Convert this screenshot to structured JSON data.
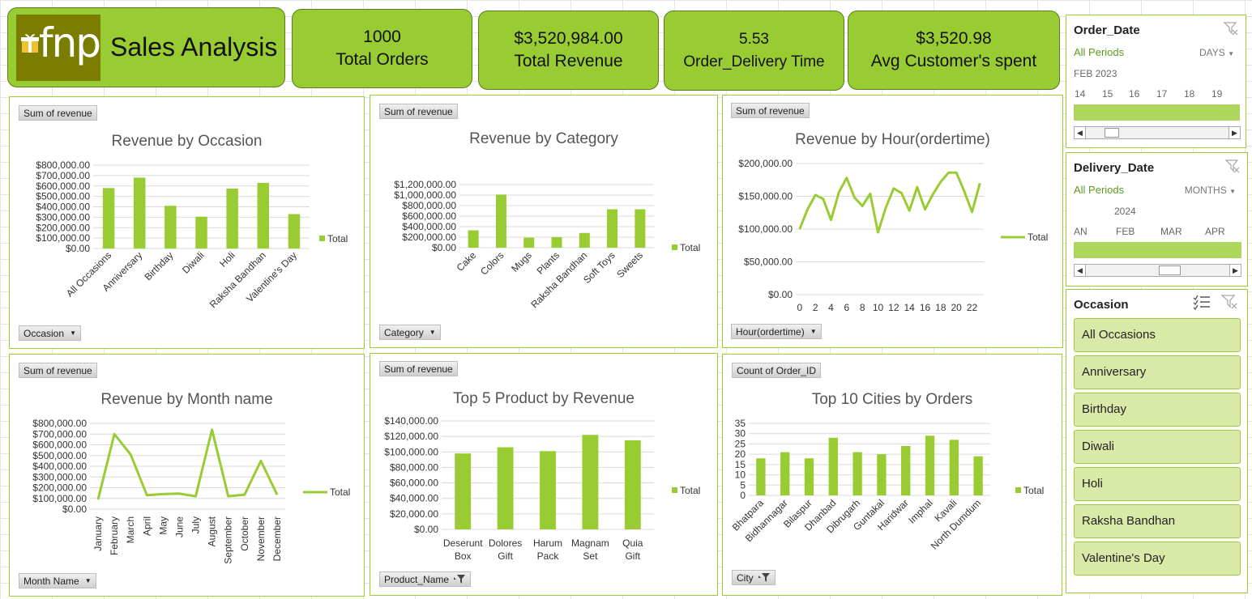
{
  "header": {
    "logo_text": "fnp",
    "title": "Sales Analysis"
  },
  "kpis": [
    {
      "value": "1000",
      "label": "Total Orders"
    },
    {
      "value": "$3,520,984.00",
      "label": "Total Revenue"
    },
    {
      "value": "5.53",
      "label": "Order_Delivery Time"
    },
    {
      "value": "$3,520.98",
      "label": "Avg Customer's spent"
    }
  ],
  "colors": {
    "accent": "#99cc33",
    "bar": "#99cc33",
    "line": "#99cc33",
    "slicer_fill": "#d9eaa8",
    "border": "#9acd32"
  },
  "legend_label": "Total",
  "chart_data": [
    {
      "id": "occasion",
      "type": "bar",
      "title": "Revenue by Occasion",
      "value_field": "Sum of revenue",
      "axis_field": "Occasion",
      "categories": [
        "All Occasions",
        "Anniversary",
        "Birthday",
        "Diwali",
        "Holi",
        "Raksha Bandhan",
        "Valentine's Day"
      ],
      "values": [
        580000,
        680000,
        410000,
        305000,
        575000,
        630000,
        330000
      ],
      "yticks": [
        "$0.00",
        "$100,000.00",
        "$200,000.00",
        "$300,000.00",
        "$400,000.00",
        "$500,000.00",
        "$600,000.00",
        "$700,000.00",
        "$800,000.00"
      ],
      "ylim": [
        0,
        800000
      ],
      "legend": "right"
    },
    {
      "id": "category",
      "type": "bar",
      "title": "Revenue by Category",
      "value_field": "Sum of revenue",
      "axis_field": "Category",
      "categories": [
        "Cake",
        "Colors",
        "Mugs",
        "Plants",
        "Raksha Bandhan",
        "Soft Toys",
        "Sweets"
      ],
      "values": [
        330000,
        1010000,
        190000,
        200000,
        280000,
        730000,
        730000
      ],
      "yticks": [
        "$0.00",
        "$200,000.00",
        "$400,000.00",
        "$600,000.00",
        "$800,000.00",
        "$1,000,000.00",
        "$1,200,000.00"
      ],
      "ylim": [
        0,
        1200000
      ],
      "legend": "right"
    },
    {
      "id": "hour",
      "type": "line",
      "title": "Revenue by Hour(ordertime)",
      "value_field": "Sum of revenue",
      "axis_field": "Hour(ordertime)",
      "x": [
        0,
        1,
        2,
        3,
        4,
        5,
        6,
        7,
        8,
        9,
        10,
        11,
        12,
        13,
        14,
        15,
        16,
        17,
        18,
        19,
        20,
        21,
        22,
        23
      ],
      "values": [
        100000,
        130000,
        152000,
        146000,
        114000,
        156000,
        178000,
        148000,
        135000,
        154000,
        95000,
        133000,
        162000,
        155000,
        128000,
        164000,
        130000,
        153000,
        172000,
        186000,
        186000,
        158000,
        126000,
        170000
      ],
      "xticks": [
        "0",
        "2",
        "4",
        "6",
        "8",
        "10",
        "12",
        "14",
        "16",
        "18",
        "20",
        "22"
      ],
      "yticks": [
        "$0.00",
        "$50,000.00",
        "$100,000.00",
        "$150,000.00",
        "$200,000.00"
      ],
      "ylim": [
        0,
        200000
      ],
      "legend": "right"
    },
    {
      "id": "month",
      "type": "line",
      "title": "Revenue by Month name",
      "value_field": "Sum of revenue",
      "axis_field": "Month Name",
      "categories": [
        "January",
        "February",
        "March",
        "April",
        "May",
        "June",
        "July",
        "August",
        "September",
        "October",
        "November",
        "December"
      ],
      "values": [
        90000,
        700000,
        510000,
        130000,
        140000,
        145000,
        120000,
        740000,
        120000,
        135000,
        450000,
        135000
      ],
      "yticks": [
        "$0.00",
        "$100,000.00",
        "$200,000.00",
        "$300,000.00",
        "$400,000.00",
        "$500,000.00",
        "$600,000.00",
        "$700,000.00",
        "$800,000.00"
      ],
      "ylim": [
        0,
        800000
      ],
      "legend": "right"
    },
    {
      "id": "product",
      "type": "bar",
      "title": "Top 5 Product by Revenue",
      "value_field": "Sum of revenue",
      "axis_field": "Product_Name",
      "categories": [
        "Deserunt Box",
        "Dolores Gift",
        "Harum Pack",
        "Magnam Set",
        "Quia Gift"
      ],
      "values": [
        98000,
        106000,
        101000,
        122000,
        115000
      ],
      "yticks": [
        "$0.00",
        "$20,000.00",
        "$40,000.00",
        "$60,000.00",
        "$80,000.00",
        "$100,000.00",
        "$120,000.00",
        "$140,000.00"
      ],
      "ylim": [
        0,
        140000
      ],
      "legend": "right"
    },
    {
      "id": "cities",
      "type": "bar",
      "title": "Top 10 Cities by Orders",
      "value_field": "Count of Order_ID",
      "axis_field": "City",
      "categories": [
        "Bhatpara",
        "Bidhannagar",
        "Bilaspur",
        "Dhanbad",
        "Dibrugarh",
        "Guntakal",
        "Haridwar",
        "Imphal",
        "Kavali",
        "North Dumdum"
      ],
      "values": [
        18,
        21,
        18,
        28,
        21,
        20,
        24,
        29,
        27,
        19
      ],
      "yticks": [
        "0",
        "5",
        "10",
        "15",
        "20",
        "25",
        "30",
        "35"
      ],
      "ylim": [
        0,
        35
      ],
      "legend": "right"
    }
  ],
  "slicers": {
    "order_date": {
      "title": "Order_Date",
      "all": "All Periods",
      "unit": "DAYS",
      "period": "FEB 2023",
      "ticks": [
        "14",
        "15",
        "16",
        "17",
        "18",
        "19"
      ]
    },
    "delivery_date": {
      "title": "Delivery_Date",
      "all": "All Periods",
      "unit": "MONTHS",
      "period": "2024",
      "ticks": [
        "AN",
        "FEB",
        "MAR",
        "APR"
      ]
    },
    "occasion": {
      "title": "Occasion",
      "items": [
        "All Occasions",
        "Anniversary",
        "Birthday",
        "Diwali",
        "Holi",
        "Raksha Bandhan",
        "Valentine's Day"
      ]
    }
  }
}
